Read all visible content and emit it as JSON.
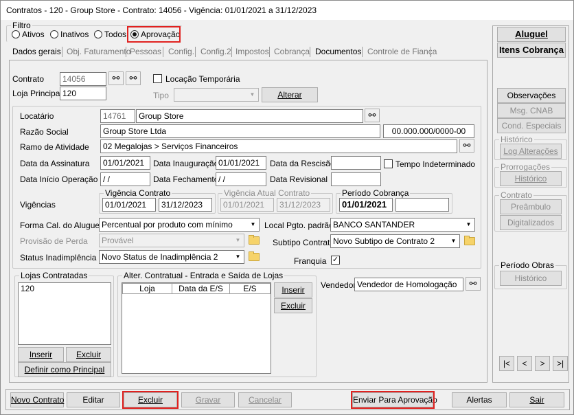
{
  "window": {
    "title": "Contratos - 120 - Group Store - Contrato: 14056 - Vigência: 01/01/2021 a 31/12/2023"
  },
  "filtro": {
    "label": "Filtro",
    "options": [
      "Ativos",
      "Inativos",
      "Todos",
      "Aprovação"
    ],
    "selected": "Aprovação"
  },
  "tabs": [
    "Dados gerais",
    "Obj. Faturamento",
    "Pessoas",
    "Config.",
    "Config.2",
    "Impostos",
    "Cobrança",
    "Documentos",
    "Controle de Fiança"
  ],
  "contrato": {
    "label": "Contrato",
    "value": "14056"
  },
  "loja_principal": {
    "label": "Loja Principal",
    "value": "120"
  },
  "locacao_temporaria": "Locação Temporária",
  "tipo": {
    "label": "Tipo",
    "value": ""
  },
  "alterar_btn": "Alterar",
  "locatario": {
    "label": "Locatário",
    "code": "14761",
    "name": "Group Store"
  },
  "razao_social": {
    "label": "Razão Social",
    "value": "Group Store Ltda",
    "cnpj": "00.000.000/0000-00"
  },
  "ramo": {
    "label": "Ramo de Atividade",
    "value": "02 Megalojas > Serviços Financeiros"
  },
  "datas": {
    "assinatura": {
      "label": "Data da Assinatura",
      "value": "01/01/2021"
    },
    "inauguracao": {
      "label": "Data Inauguração",
      "value": "01/01/2021"
    },
    "rescisao": {
      "label": "Data da Rescisão",
      "value": ""
    },
    "tempo_indeterminado": "Tempo Indeterminado",
    "inicio_operacao": {
      "label": "Data Início Operação",
      "value": " / /"
    },
    "fechamento": {
      "label": "Data Fechamento",
      "value": " / /"
    },
    "revisional": {
      "label": "Data Revisional",
      "value": ""
    }
  },
  "vigencias": {
    "label": "Vigências",
    "contrato": {
      "label": "Vigência Contrato",
      "inicio": "01/01/2021",
      "fim": "31/12/2023"
    },
    "atual": {
      "label": "Vigência Atual Contrato",
      "inicio": "01/01/2021",
      "fim": "31/12/2023"
    },
    "cobranca": {
      "label": "Período Cobrança",
      "inicio": "01/01/2021",
      "fim": ""
    }
  },
  "forma_cal": {
    "label": "Forma Cal. do Aluguel",
    "value": "Percentual por produto com mínimo"
  },
  "local_pgto": {
    "label": "Local Pgto. padrão",
    "value": "BANCO SANTANDER"
  },
  "provisao": {
    "label": "Provisão de Perda",
    "value": "Provável"
  },
  "subtipo": {
    "label": "Subtipo Contrato",
    "value": "Novo Subtipo de Contrato 2"
  },
  "status_inad": {
    "label": "Status Inadimplência",
    "value": "Novo Status de Inadimplência 2"
  },
  "franquia": {
    "label": "Franquia",
    "checked": true,
    "mark": "✓"
  },
  "lojas": {
    "label": "Lojas Contratadas",
    "items": [
      "120"
    ],
    "inserir": "Inserir",
    "excluir": "Excluir",
    "definir": "Definir como Principal"
  },
  "alter": {
    "label": "Alter. Contratual - Entrada e Saída de Lojas",
    "columns": [
      "Loja",
      "Data da E/S",
      "E/S"
    ],
    "inserir": "Inserir",
    "excluir": "Excluir"
  },
  "vendedor": {
    "label": "Vendedor",
    "value": "Vendedor de Homologação"
  },
  "right": {
    "aluguel": "Aluguel",
    "itens_cobranca": "Itens Cobrança",
    "observacoes": "Observações",
    "msg_cnab": "Msg. CNAB",
    "cond_especiais": "Cond. Especiais",
    "historico_group": "Histórico",
    "log_alteracoes": "Log Alterações",
    "prorrogacoes_group": "Prorrogações",
    "historico": "Histórico",
    "contrato_group": "Contrato",
    "preambulo": "Preâmbulo",
    "digitalizados": "Digitalizados",
    "periodo_obras": "Período Obras",
    "historico2": "Histórico"
  },
  "nav": [
    "|<",
    "<",
    ">",
    ">|"
  ],
  "bottom": {
    "novo": "Novo Contrato",
    "editar": "Editar",
    "excluir": "Excluir",
    "gravar": "Gravar",
    "cancelar": "Cancelar",
    "enviar": "Enviar Para Aprovação",
    "alertas": "Alertas",
    "sair": "Sair"
  },
  "colors": {
    "highlight": "#e0211f",
    "title_bg": "#ffffff",
    "window_bg": "#f0f0f0"
  }
}
